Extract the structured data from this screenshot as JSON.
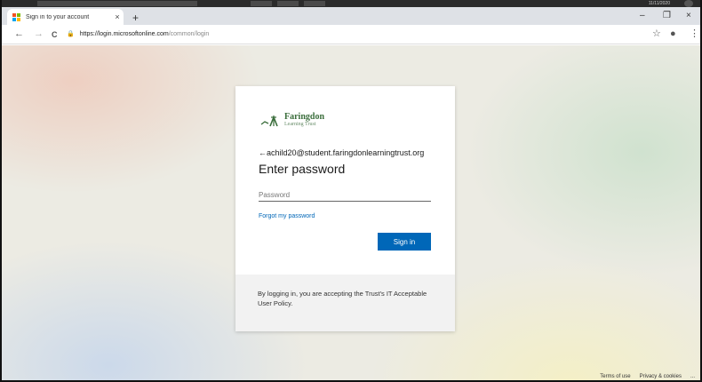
{
  "os": {
    "clock": "11/11/2020"
  },
  "browser": {
    "tab_title": "Sign in to your account",
    "tab_close": "×",
    "new_tab": "+",
    "minimize": "–",
    "restore": "❐",
    "close": "×",
    "back": "←",
    "forward": "→",
    "reload": "C",
    "url_host": "https://login.microsoftonline.com",
    "url_path": "/common/login",
    "bookmark": "☆",
    "profile": "●",
    "menu": "⋮"
  },
  "login": {
    "logo_line1": "Faringdon",
    "logo_line2": "Learning Trust",
    "identity": "←achild20@student.faringdonlearningtrust.org",
    "heading": "Enter password",
    "password_placeholder": "Password",
    "forgot_label": "Forgot my password",
    "signin_label": "Sign in",
    "footer_text": "By logging in, you are accepting the Trust's IT Acceptable User Policy."
  },
  "page_footer": {
    "terms": "Terms of use",
    "privacy": "Privacy & cookies",
    "more": "..."
  },
  "colors": {
    "accent": "#0067b8",
    "logo_green": "#3b6e3c"
  }
}
